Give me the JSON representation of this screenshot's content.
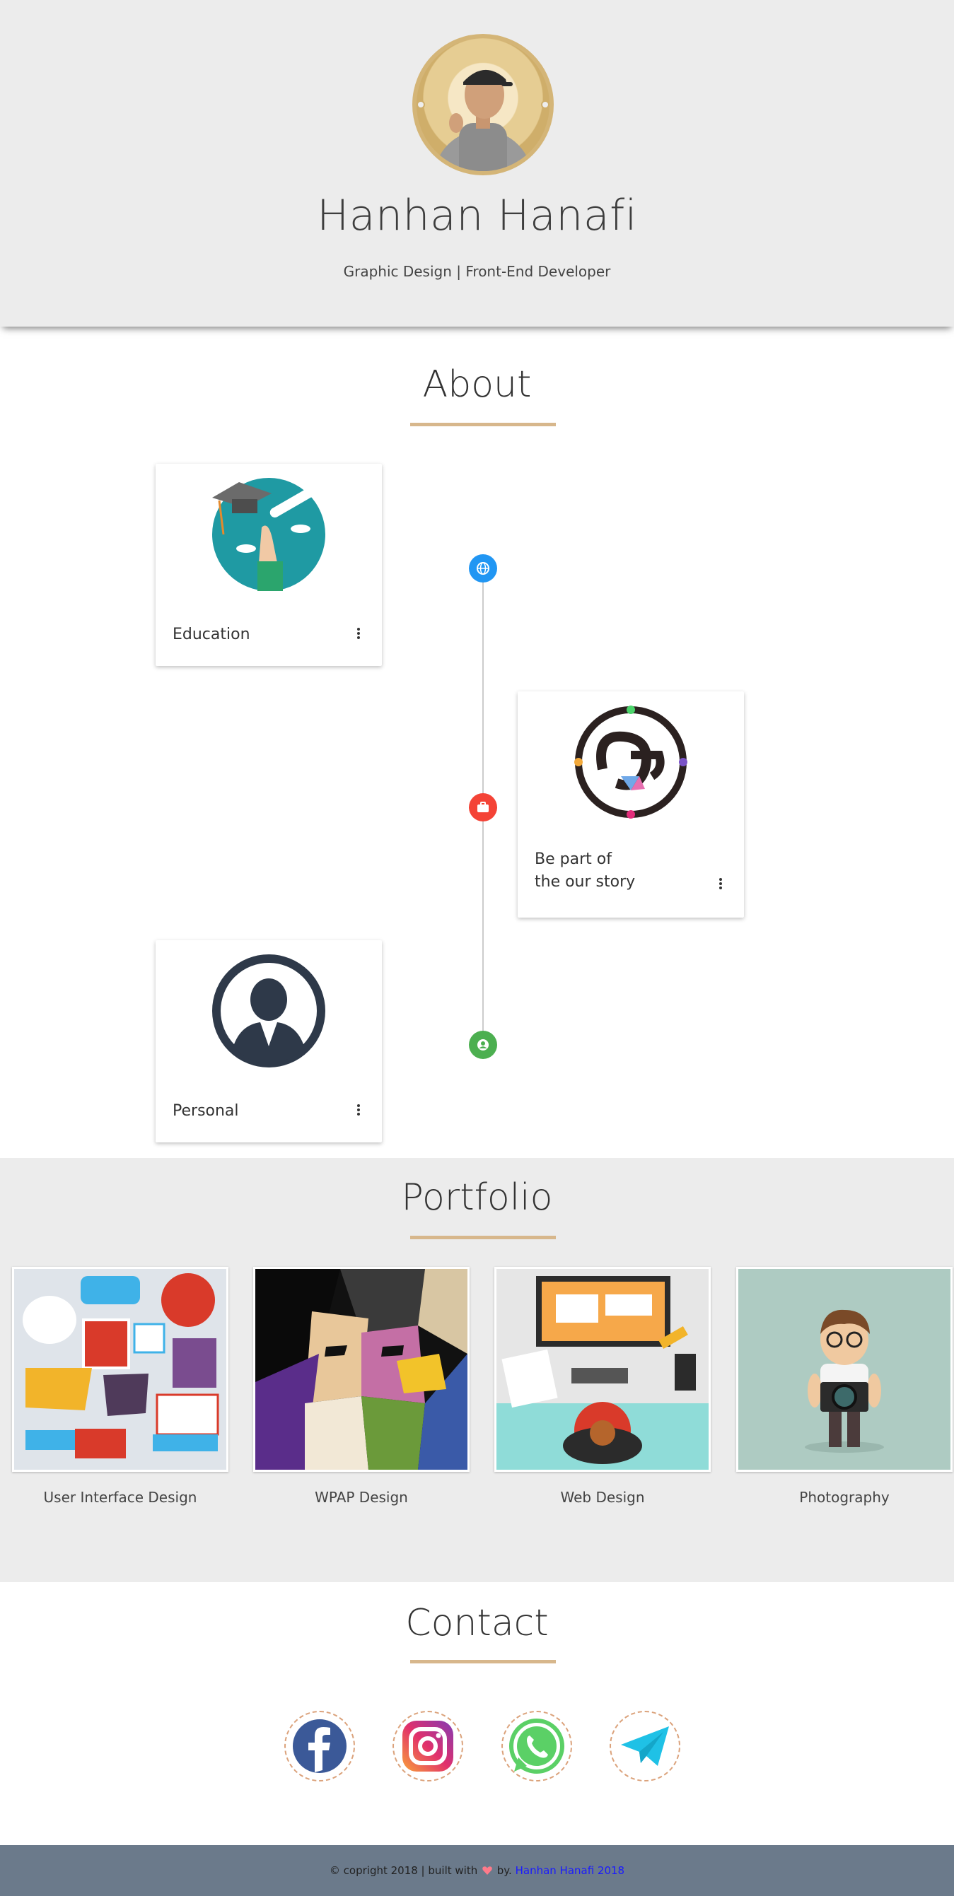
{
  "header": {
    "name": "Hanhan Hanafi",
    "subtitle": "Graphic Design | Front-End Developer",
    "avatar_icon": "profile-photo"
  },
  "about": {
    "title": "About",
    "cards": [
      {
        "label": "Education",
        "icon": "graduation-icon",
        "timeline_icon": "globe-icon",
        "timeline_color": "#2196f3"
      },
      {
        "label_line1": "Be part of",
        "label_line2": "the our story",
        "icon": "logo-hh-icon",
        "timeline_icon": "briefcase-icon",
        "timeline_color": "#f44336"
      },
      {
        "label": "Personal",
        "icon": "user-icon",
        "timeline_icon": "person-icon",
        "timeline_color": "#4caf50"
      }
    ]
  },
  "portfolio": {
    "title": "Portfolio",
    "items": [
      {
        "label": "User Interface Design"
      },
      {
        "label": "WPAP Design"
      },
      {
        "label": "Web Design"
      },
      {
        "label": "Photography"
      }
    ]
  },
  "contact": {
    "title": "Contact",
    "socials": [
      "facebook-icon",
      "instagram-icon",
      "whatsapp-icon",
      "telegram-icon"
    ]
  },
  "footer": {
    "text": "© copright 2018 | built with",
    "by": "by.",
    "author": "Hanhan Hanafi 2018"
  },
  "colors": {
    "accent": "#d7b78c",
    "footer_bg": "#6b7a8b",
    "link": "#1a1aff"
  }
}
